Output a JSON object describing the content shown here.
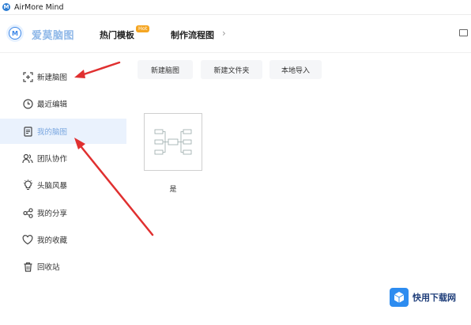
{
  "window": {
    "title": "AirMore Mind"
  },
  "header": {
    "logo_letter": "M",
    "brand": "爱莫脑图",
    "tabs": [
      {
        "label": "热门模板",
        "badge": "Hot"
      },
      {
        "label": "制作流程图"
      }
    ],
    "chevron": "›"
  },
  "sidebar": {
    "items": [
      {
        "label": "新建脑图",
        "icon": "new-file-icon"
      },
      {
        "label": "最近编辑",
        "icon": "clock-icon"
      },
      {
        "label": "我的脑图",
        "icon": "document-icon",
        "active": true
      },
      {
        "label": "团队协作",
        "icon": "team-icon"
      },
      {
        "label": "头脑风暴",
        "icon": "lightbulb-icon"
      },
      {
        "label": "我的分享",
        "icon": "share-icon"
      },
      {
        "label": "我的收藏",
        "icon": "heart-icon"
      },
      {
        "label": "回收站",
        "icon": "trash-icon"
      }
    ]
  },
  "toolbar": {
    "buttons": [
      "新建脑图",
      "新建文件夹",
      "本地导入"
    ]
  },
  "files": [
    {
      "name": "是",
      "icon": "mindmap-thumbnail"
    }
  ],
  "watermark": {
    "text": "快用下载网",
    "icon": "cube-icon"
  },
  "colors": {
    "accent": "#3b86e8",
    "active_bg": "#eaf2fd",
    "arrow": "#e03030",
    "badge": "#f5a623"
  }
}
